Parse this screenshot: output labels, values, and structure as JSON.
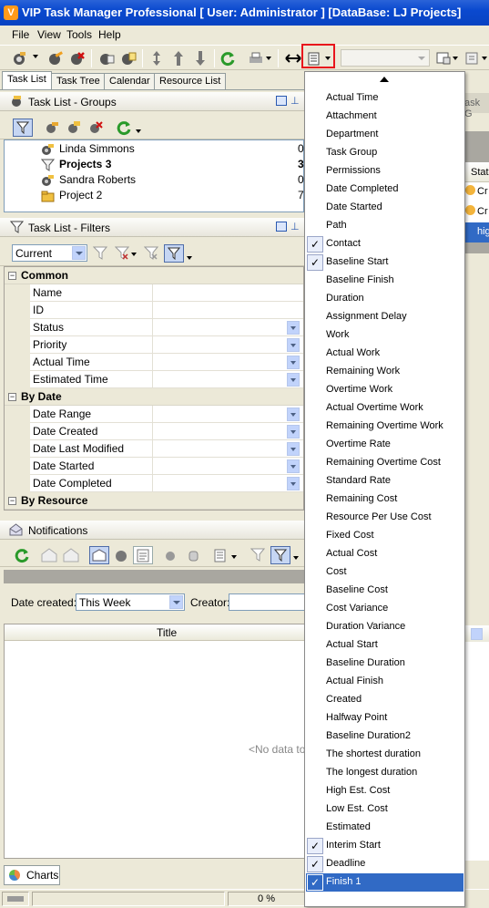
{
  "window": {
    "title": "VIP Task Manager Professional [ User: Administrator ] [DataBase: LJ Projects]"
  },
  "menubar": [
    {
      "label": "File"
    },
    {
      "label": "View"
    },
    {
      "label": "Tools"
    },
    {
      "label": "Help"
    }
  ],
  "tabs": [
    {
      "label": "Task List",
      "active": true
    },
    {
      "label": "Task Tree"
    },
    {
      "label": "Calendar"
    },
    {
      "label": "Resource List"
    }
  ],
  "groups_panel": {
    "title": "Task List - Groups",
    "items": [
      {
        "label": "Linda Simmons",
        "count": "0",
        "bold": false
      },
      {
        "label": "Projects 3",
        "count": "3",
        "bold": true
      },
      {
        "label": "Sandra Roberts",
        "count": "0",
        "bold": false
      },
      {
        "label": "Project 2",
        "count": "7",
        "bold": false
      }
    ]
  },
  "filters_panel": {
    "title": "Task List - Filters",
    "filter_combo": "Current",
    "categories": [
      {
        "label": "Common",
        "props": [
          {
            "name": "Name",
            "dropdown": false
          },
          {
            "name": "ID",
            "dropdown": false
          },
          {
            "name": "Status",
            "dropdown": true
          },
          {
            "name": "Priority",
            "dropdown": true
          },
          {
            "name": "Actual Time",
            "dropdown": true
          },
          {
            "name": "Estimated Time",
            "dropdown": true
          }
        ]
      },
      {
        "label": "By Date",
        "props": [
          {
            "name": "Date Range",
            "dropdown": true
          },
          {
            "name": "Date Created",
            "dropdown": true
          },
          {
            "name": "Date Last Modified",
            "dropdown": true
          },
          {
            "name": "Date Started",
            "dropdown": true
          },
          {
            "name": "Date Completed",
            "dropdown": true
          }
        ]
      },
      {
        "label": "By Resource",
        "props": []
      }
    ]
  },
  "notifications": {
    "title": "Notifications",
    "date_created_label": "Date created:",
    "date_created_value": "This Week",
    "creator_label": "Creator:",
    "title_column": "Title",
    "no_data": "<No data to d"
  },
  "bottom": {
    "charts_label": "Charts",
    "progress_text": "0 %"
  },
  "behind_right": {
    "items": [
      "ask G",
      "Stat",
      "Cr",
      "Cr",
      "hig"
    ]
  },
  "column_menu": {
    "items": [
      {
        "label": "Actual Time",
        "checked": false
      },
      {
        "label": "Attachment",
        "checked": false
      },
      {
        "label": "Department",
        "checked": false
      },
      {
        "label": "Task Group",
        "checked": false
      },
      {
        "label": "Permissions",
        "checked": false
      },
      {
        "label": "Date Completed",
        "checked": false
      },
      {
        "label": "Date Started",
        "checked": false
      },
      {
        "label": "Path",
        "checked": false
      },
      {
        "label": "Contact",
        "checked": true
      },
      {
        "label": "Baseline Start",
        "checked": true
      },
      {
        "label": "Baseline Finish",
        "checked": false
      },
      {
        "label": "Duration",
        "checked": false
      },
      {
        "label": "Assignment Delay",
        "checked": false
      },
      {
        "label": "Work",
        "checked": false
      },
      {
        "label": "Actual Work",
        "checked": false
      },
      {
        "label": "Remaining Work",
        "checked": false
      },
      {
        "label": "Overtime Work",
        "checked": false
      },
      {
        "label": "Actual Overtime Work",
        "checked": false
      },
      {
        "label": "Remaining Overtime Work",
        "checked": false
      },
      {
        "label": "Overtime Rate",
        "checked": false
      },
      {
        "label": "Remaining Overtime Cost",
        "checked": false
      },
      {
        "label": "Standard Rate",
        "checked": false
      },
      {
        "label": "Remaining Cost",
        "checked": false
      },
      {
        "label": "Resource Per Use Cost",
        "checked": false
      },
      {
        "label": "Fixed Cost",
        "checked": false
      },
      {
        "label": "Actual Cost",
        "checked": false
      },
      {
        "label": "Cost",
        "checked": false
      },
      {
        "label": "Baseline Cost",
        "checked": false
      },
      {
        "label": "Cost Variance",
        "checked": false
      },
      {
        "label": "Duration Variance",
        "checked": false
      },
      {
        "label": "Actual Start",
        "checked": false
      },
      {
        "label": "Baseline Duration",
        "checked": false
      },
      {
        "label": "Actual Finish",
        "checked": false
      },
      {
        "label": "Created",
        "checked": false
      },
      {
        "label": "Halfway Point",
        "checked": false
      },
      {
        "label": "Baseline Duration2",
        "checked": false
      },
      {
        "label": "The shortest duration",
        "checked": false
      },
      {
        "label": "The longest duration",
        "checked": false
      },
      {
        "label": "High Est. Cost",
        "checked": false
      },
      {
        "label": "Low Est. Cost",
        "checked": false
      },
      {
        "label": "Estimated",
        "checked": false
      },
      {
        "label": "Interim Start",
        "checked": true
      },
      {
        "label": "Deadline",
        "checked": true
      },
      {
        "label": "Finish 1",
        "checked": true,
        "selected": true
      }
    ]
  },
  "colors": {
    "accent": "#316ac5",
    "titlebar": "#0a49cf",
    "highlight": "#e8141c"
  }
}
